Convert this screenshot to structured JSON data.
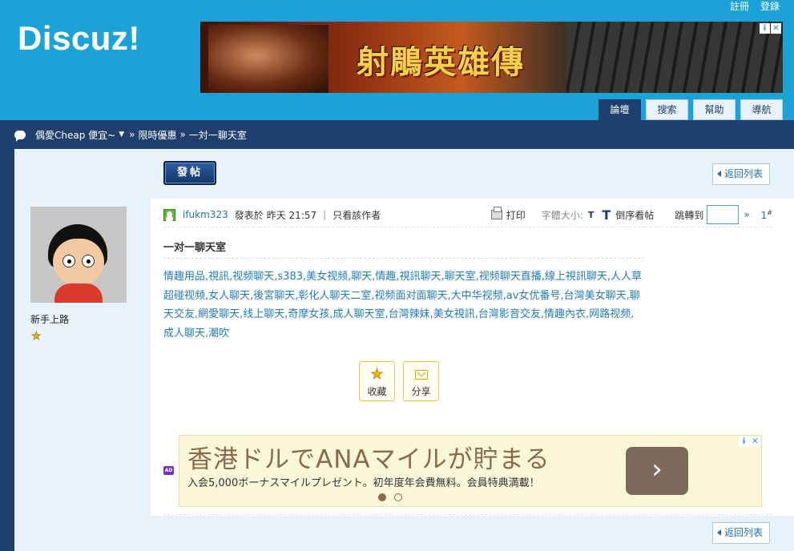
{
  "top_links": [
    "註冊",
    "登錄"
  ],
  "logo": "Discuz!",
  "banner": {
    "title": "射鵰英雄傳",
    "choice_icons": [
      "i",
      "✕"
    ]
  },
  "nav": [
    {
      "label": "論壇",
      "active": true
    },
    {
      "label": "搜索",
      "active": false
    },
    {
      "label": "幫助",
      "active": false
    },
    {
      "label": "導航",
      "active": false
    }
  ],
  "breadcrumb": {
    "forum": "偶愛Cheap 便宜~",
    "sep1": "»",
    "section": "限時優惠",
    "sep2": "»",
    "thread": "一対一聊天室"
  },
  "toolbar": {
    "post_button": "發帖",
    "back_button": "返回列表"
  },
  "author": {
    "rank": "新手上路",
    "stars": 1
  },
  "post_meta": {
    "username": "ifukm323",
    "posted_prefix": "發表於",
    "posted_time": "昨天 21:57",
    "divider": "|",
    "only_author": "只看該作者",
    "print": "打印",
    "font_size_label": "字體大小:",
    "font_small": "T",
    "font_big": "T",
    "reverse_order": "倒序看帖",
    "jump_to": "跳轉到",
    "jump_arrow": "»",
    "floor_number": "1",
    "floor_mark": "#"
  },
  "post": {
    "title": "一对一聊天室",
    "body": "情趣用品,視訊,视频聊天,s383,美女视频,聊天,情趣,視訊聊天,聊天室,视频聊天直播,線上視訊聊天,人人草超碰视频,女人聊天,後宮聊天,彰化人聊天二室,视频面对面聊天,大中华视频,av女优番号,台灣美女聊天,聊天交友,網愛聊天,线上聊天,奇摩女孩,成人聊天室,台灣辣妹,美女視訊,台灣影音交友,情趣內衣,网路视频,成人聊天,潮吹"
  },
  "actions": {
    "favorite": "收藏",
    "share": "分享"
  },
  "bottom_ad": {
    "tag": "AD",
    "headline": "香港ドルでANAマイルが貯まる",
    "subline": "入会5,000ボーナスマイルプレゼント。初年度年会費無料。会員特典満載！",
    "arrow": "›",
    "choice_icons": [
      "i",
      "✕"
    ],
    "pages": 2,
    "current_page": 1
  },
  "colors": {
    "header_bg": "#1ba3d8",
    "nav_dark": "#1f3f6e",
    "panel_bg": "#e8f2fb",
    "link": "#1f7ab8"
  }
}
